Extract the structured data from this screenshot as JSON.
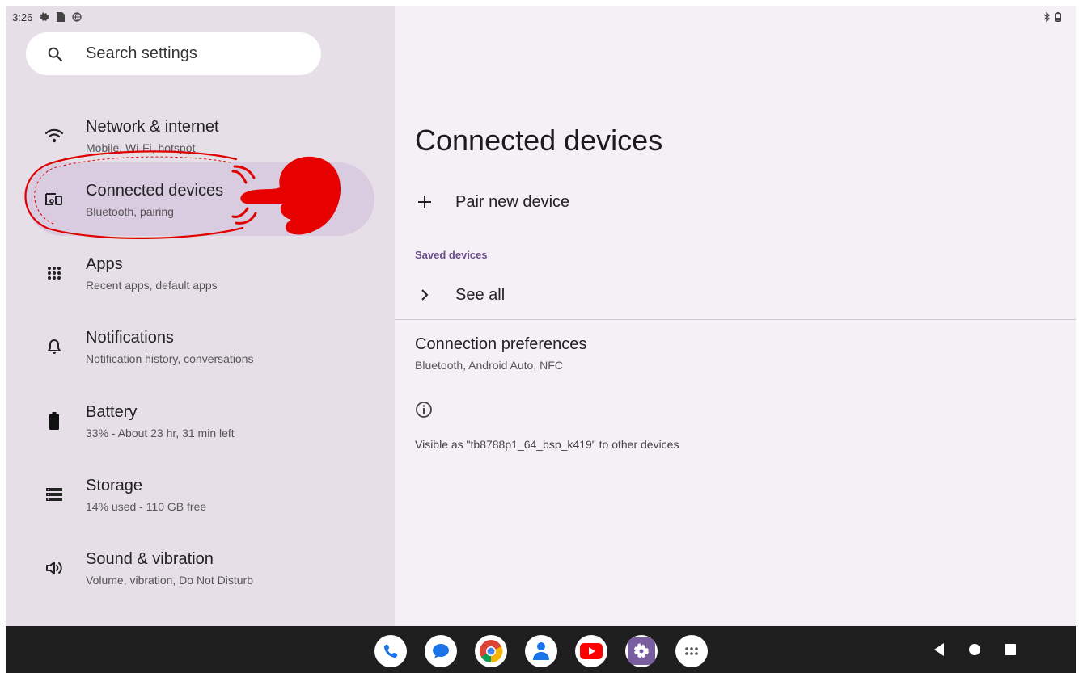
{
  "status_bar": {
    "time": "3:26",
    "left_icons": [
      "gear-icon",
      "sim-card-icon",
      "globe-icon"
    ],
    "right_icons": [
      "bluetooth-icon",
      "battery-icon"
    ]
  },
  "search": {
    "placeholder": "Search settings"
  },
  "menu": [
    {
      "title": "Network & internet",
      "subtitle": "Mobile, Wi-Fi, hotspot",
      "icon": "wifi-icon"
    },
    {
      "title": "Connected devices",
      "subtitle": "Bluetooth, pairing",
      "icon": "devices-icon",
      "selected": true
    },
    {
      "title": "Apps",
      "subtitle": "Recent apps, default apps",
      "icon": "apps-grid-icon"
    },
    {
      "title": "Notifications",
      "subtitle": "Notification history, conversations",
      "icon": "bell-icon"
    },
    {
      "title": "Battery",
      "subtitle": "33% - About 23 hr, 31 min left",
      "icon": "battery-icon"
    },
    {
      "title": "Storage",
      "subtitle": "14% used - 110 GB free",
      "icon": "storage-icon"
    },
    {
      "title": "Sound & vibration",
      "subtitle": "Volume, vibration, Do Not Disturb",
      "icon": "speaker-icon"
    }
  ],
  "content": {
    "title": "Connected devices",
    "pair_new": "Pair new device",
    "saved_header": "Saved devices",
    "see_all": "See all",
    "conn_prefs_title": "Connection preferences",
    "conn_prefs_subtitle": "Bluetooth, Android Auto, NFC",
    "visible_as": "Visible as \"tb8788p1_64_bsp_k419\" to other devices"
  },
  "taskbar": {
    "apps": [
      "phone-app-icon",
      "messages-app-icon",
      "chrome-app-icon",
      "contacts-app-icon",
      "youtube-app-icon",
      "settings-app-icon",
      "app-drawer-icon"
    ],
    "nav": [
      "back-icon",
      "home-icon",
      "recents-icon"
    ]
  },
  "colors": {
    "left_pane": "#e6dfe8",
    "right_pane": "#f5eff6",
    "selected": "#d9cbe0",
    "accent": "#6a4f8a",
    "annotation": "#e00000"
  }
}
